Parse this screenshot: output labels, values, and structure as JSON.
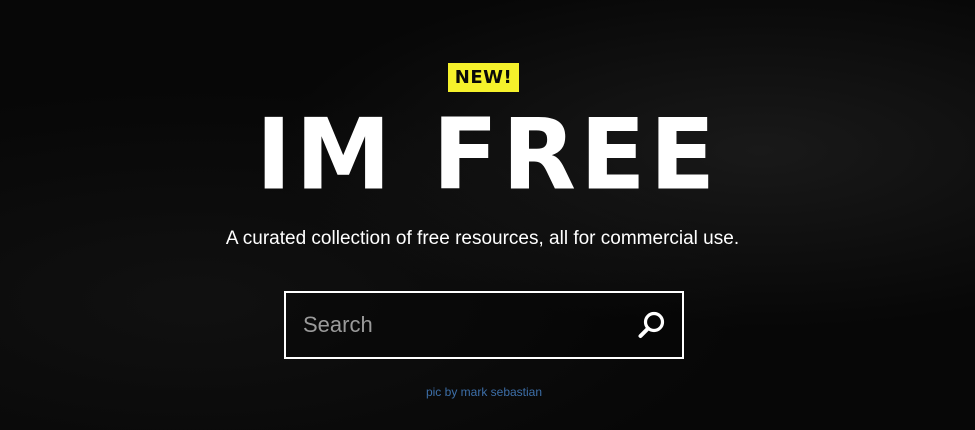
{
  "badge": {
    "label": "NEW!"
  },
  "hero": {
    "title": "IM FREE",
    "tagline": "A curated collection of free resources, all for commercial use."
  },
  "search": {
    "placeholder": "Search",
    "value": "",
    "icon": "search-icon"
  },
  "credit": {
    "text": "pic by mark sebastian"
  },
  "colors": {
    "background": "#070707",
    "badge": "#f5f12b",
    "text": "#ffffff",
    "credit_link": "#3d6fa8"
  }
}
